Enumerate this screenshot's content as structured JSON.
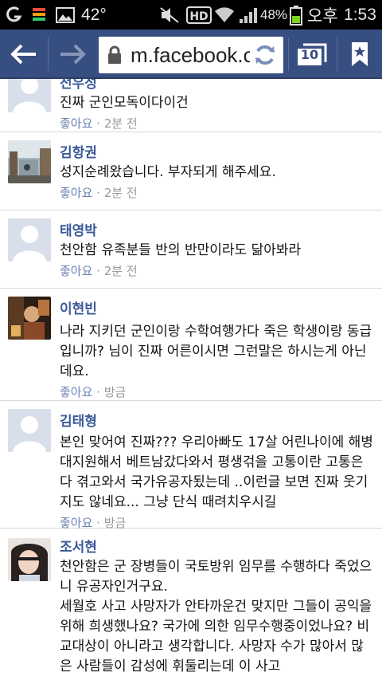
{
  "status_bar": {
    "temperature": "42°",
    "battery": "48%",
    "ampm": "오후",
    "time": "1:53",
    "icons": [
      "g-icon",
      "sd-card-icon",
      "gallery-icon",
      "mute-icon",
      "hd-icon",
      "wifi-icon",
      "signal-icon",
      "battery-icon"
    ]
  },
  "browser": {
    "url": "m.facebook.c",
    "tab_count": "10",
    "colors": {
      "toolbar": "#374e80",
      "accent_name": "#3b5998"
    }
  },
  "comments": [
    {
      "name": "전우성",
      "text": "진짜 군인모독이다이건",
      "like": "좋아요",
      "time": "2분 전",
      "avatar": "default"
    },
    {
      "name": "김항권",
      "text": "성지순례왔습니다. 부자되게 해주세요.",
      "like": "좋아요",
      "time": "2분 전",
      "avatar": "photo-street"
    },
    {
      "name": "태영박",
      "text": "천안함 유족분들 반의 반만이라도 닮아봐라",
      "like": "좋아요",
      "time": "2분 전",
      "avatar": "default"
    },
    {
      "name": "이현빈",
      "text": "나라 지키던 군인이랑 수학여행가다 죽은 학생이랑 동급입니까? 님이 진짜 어른이시면 그런말은 하시는게 아닌데요.",
      "like": "좋아요",
      "time": "방금",
      "avatar": "photo-dark"
    },
    {
      "name": "김태형",
      "text": "본인 맞어여 진짜??? 우리아빠도 17살 어린나이에 해병대지원해서 베트남갔다와서 평생걲을 고통이란 고통은 다 겪고와서 국가유공자됬는데 ..이런글 보면 진짜 웃기지도 않네요... 그냥 단식 때려치우시길",
      "like": "좋아요",
      "time": "방금",
      "avatar": "default"
    },
    {
      "name": "조서현",
      "text": "천안함은 군 장병들이 국토방위 임무를 수행하다 죽었으니 유공자인거구요.\n세월호 사고 사망자가 안타까운건 맞지만 그들이 공익을 위해 희생했나요? 국가에 의한 임무수행중이었나요? 비교대상이 아니라고 생각합니다. 사망자 수가 많아서 많은 사람들이 감성에 휘둘리는데 이 사고",
      "like": "",
      "time": "",
      "avatar": "photo-person"
    }
  ]
}
